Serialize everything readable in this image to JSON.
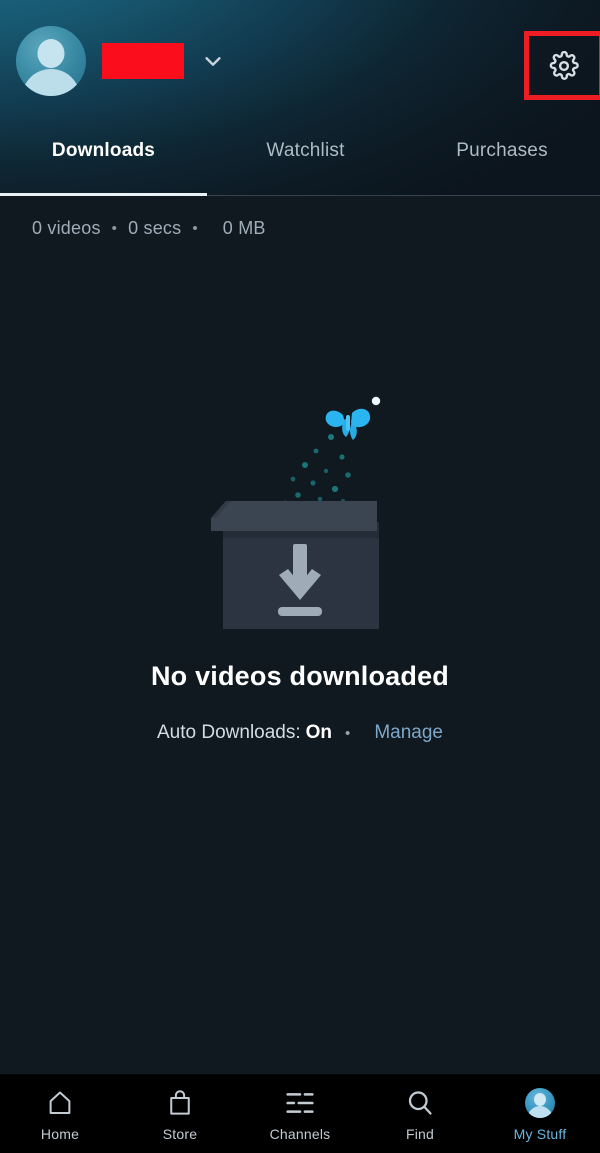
{
  "header": {
    "account_name_redacted": "",
    "avatar_icon": "person-avatar-icon",
    "chevron_icon": "chevron-down-icon",
    "settings_icon": "gear-icon",
    "annotation_color": "#ee1c23"
  },
  "tabs": [
    {
      "label": "Downloads",
      "active": true
    },
    {
      "label": "Watchlist",
      "active": false
    },
    {
      "label": "Purchases",
      "active": false
    }
  ],
  "stats": {
    "videos": "0 videos",
    "sep1": "•",
    "duration": "0 secs",
    "sep2": "•",
    "size": "0 MB"
  },
  "empty_state": {
    "illustration": "open-box-with-download-arrow-and-butterfly",
    "title": "No videos downloaded",
    "auto_downloads_label": "Auto Downloads:",
    "auto_downloads_value": "On",
    "separator": "•",
    "manage_link": "Manage"
  },
  "bottom_nav": [
    {
      "label": "Home",
      "icon": "home-icon",
      "active": false
    },
    {
      "label": "Store",
      "icon": "bag-icon",
      "active": false
    },
    {
      "label": "Channels",
      "icon": "list-icon",
      "active": false
    },
    {
      "label": "Find",
      "icon": "search-icon",
      "active": false
    },
    {
      "label": "My Stuff",
      "icon": "avatar-icon",
      "active": true
    }
  ],
  "colors": {
    "accent_blue": "#69b6dd",
    "link_blue": "#7ea7c7",
    "header_gradient_start": "#17526b",
    "header_gradient_end": "#0f1620",
    "page_background": "#101820",
    "nav_background": "#000000",
    "butterfly": "#2ab4f0",
    "sparkles": "#1c7f82",
    "redaction": "#fc0d1b"
  }
}
